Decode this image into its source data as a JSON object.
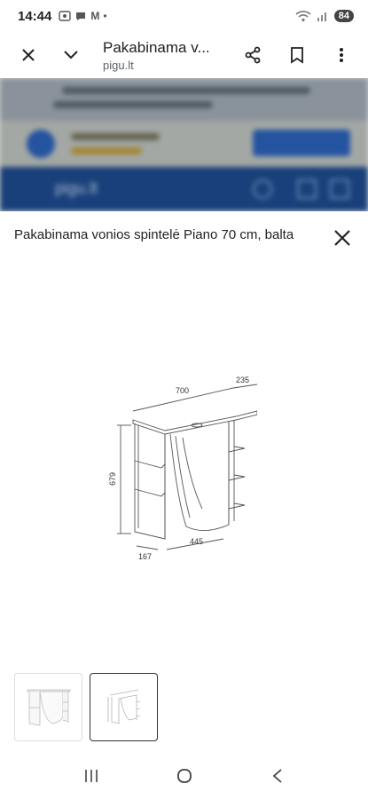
{
  "status_bar": {
    "time": "14:44",
    "indicator_m": "M",
    "indicator_dot": "•",
    "battery": "84"
  },
  "toolbar": {
    "title": "Pakabinama v...",
    "url": "pigu.lt"
  },
  "background_page": {
    "brand": "pigu.lt"
  },
  "sheet": {
    "title": "Pakabinama vonios spintelė Piano 70 cm, balta"
  },
  "diagram": {
    "width_label": "700",
    "depth_label": "235",
    "height_label": "679",
    "shelf_label": "167",
    "door_label": "445"
  },
  "thumbnails": [
    {
      "name": "cabinet-photo",
      "selected": false
    },
    {
      "name": "dimension-drawing",
      "selected": true
    }
  ],
  "colors": {
    "brand_blue": "#1f4f95",
    "overlay": "#000000"
  }
}
